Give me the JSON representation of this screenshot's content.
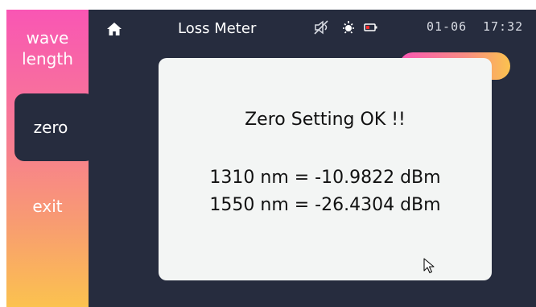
{
  "header": {
    "title": "Loss Meter",
    "date": "01-06",
    "time": "17:32"
  },
  "sidebar": {
    "wavelength_label": "wave length",
    "zero_label": "zero",
    "exit_label": "exit"
  },
  "dialog": {
    "message": "Zero Setting OK !!",
    "readings": [
      "1310 nm = -10.9822 dBm",
      "1550 nm = -26.4304 dBm"
    ]
  },
  "icons": {
    "home": "home-icon",
    "mute": "speaker-muted-icon",
    "brightness": "brightness-icon",
    "battery": "battery-low-icon",
    "cursor": "mouse-pointer-icon"
  },
  "colors": {
    "screen_bg": "#262c3e",
    "dialog_bg": "#f3f5f4",
    "gradient_top": "#f956b4",
    "gradient_bottom": "#fbc24f",
    "battery_low": "#ff2a2a"
  }
}
